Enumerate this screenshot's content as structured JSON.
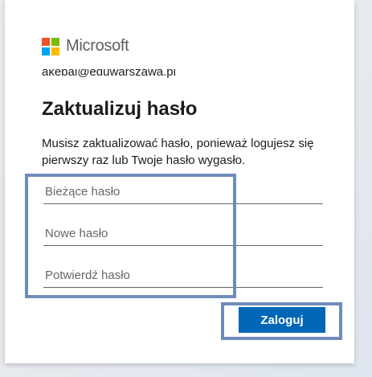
{
  "brand": {
    "name": "Microsoft",
    "logo_colors": [
      "#f25022",
      "#7fba00",
      "#00a4ef",
      "#ffb900"
    ]
  },
  "account": {
    "identity": "akebal@eduwarszawa.pl"
  },
  "page": {
    "title": "Zaktualizuj hasło",
    "description": "Musisz zaktualizować hasło, ponieważ logujesz się pierwszy raz lub Twoje hasło wygasło."
  },
  "form": {
    "current_password_placeholder": "Bieżące hasło",
    "new_password_placeholder": "Nowe hasło",
    "confirm_password_placeholder": "Potwierdź hasło",
    "submit_label": "Zaloguj"
  },
  "colors": {
    "accent": "#0067b8",
    "highlight_border": "#6f8cba"
  }
}
